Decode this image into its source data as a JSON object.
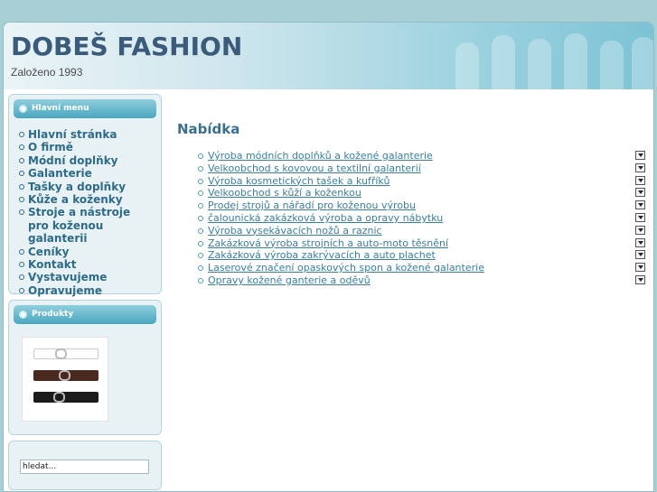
{
  "header": {
    "title": "DOBEŠ FASHION",
    "tagline": "Založeno 1993"
  },
  "sidebar": {
    "menu": {
      "heading": "Hlavní menu",
      "items": [
        {
          "label": "Hlavní stránka"
        },
        {
          "label": "O firmě"
        },
        {
          "label": "Módní doplňky"
        },
        {
          "label": "Galanterie"
        },
        {
          "label": "Tašky a doplňky"
        },
        {
          "label": "Kůže a koženky"
        },
        {
          "label": "Stroje a nástroje pro koženou galanterii"
        },
        {
          "label": "Ceníky"
        },
        {
          "label": "Kontakt"
        },
        {
          "label": "Vystavujeme"
        },
        {
          "label": "Opravujeme"
        }
      ]
    },
    "products": {
      "heading": "Produkty"
    },
    "search": {
      "value": "hledat..."
    }
  },
  "main": {
    "title": "Nabídka",
    "offers": [
      {
        "label": "Výroba módních doplňků a kožené galanterie"
      },
      {
        "label": "Velkoobchod s kovovou a textilní galanterií"
      },
      {
        "label": "Výroba kosmetických tašek a kufříků"
      },
      {
        "label": "Velkoobchod s kůží a koženkou"
      },
      {
        "label": "Prodej strojů a nářadí pro koženou výrobu"
      },
      {
        "label": "čalounická zakázková výroba a opravy nábytku"
      },
      {
        "label": "Výroba vysekávacích nožů a raznic"
      },
      {
        "label": "Zakázková výroba strojních a auto-moto těsnění"
      },
      {
        "label": "Zakázková výroba zakrývacích a auto plachet"
      },
      {
        "label": "Laserové značení opaskových spon a kožené galanterie"
      },
      {
        "label": "Opravy kožené ganterie a oděvů"
      }
    ]
  },
  "colors": {
    "accent": "#4aa7bf",
    "link": "#3a7ea0",
    "title": "#3b5b7a"
  }
}
